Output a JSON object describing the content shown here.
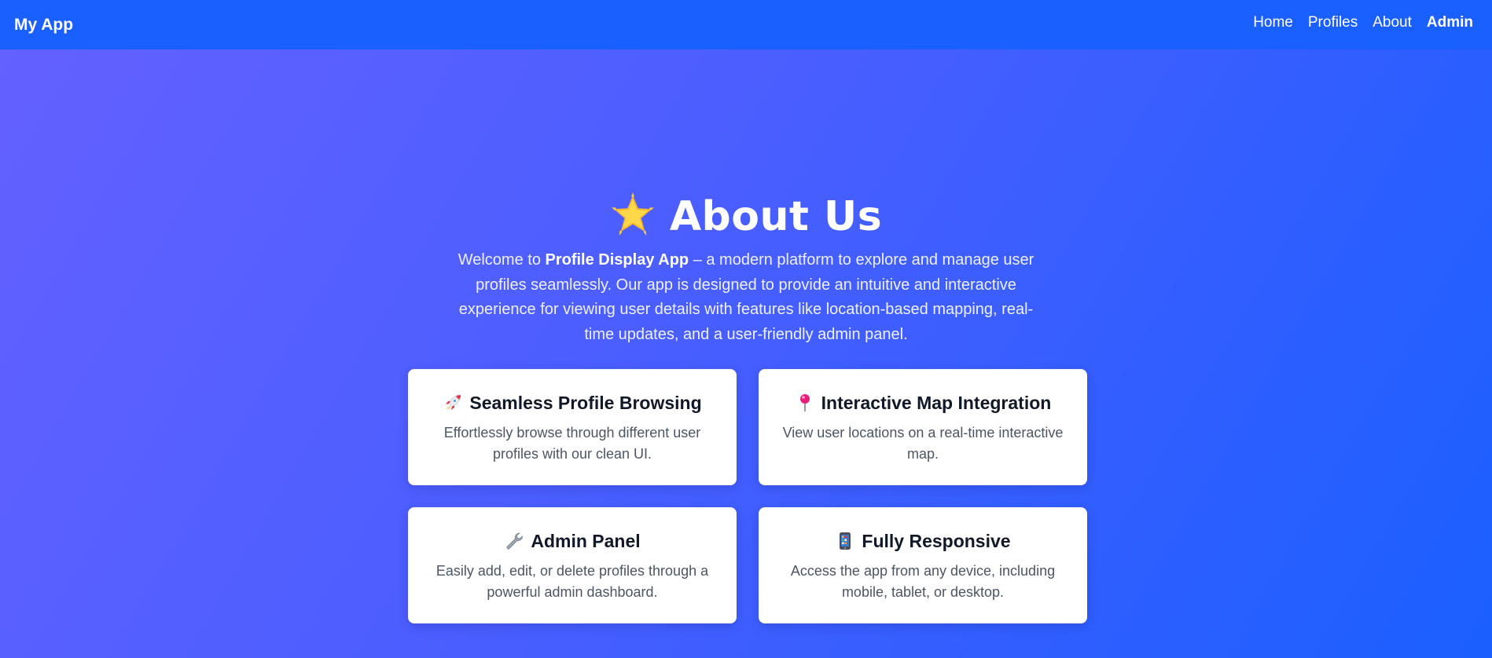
{
  "navbar": {
    "brand": "My App",
    "links": [
      {
        "label": "Home",
        "bold": false
      },
      {
        "label": "Profiles",
        "bold": false
      },
      {
        "label": "About",
        "bold": false
      },
      {
        "label": "Admin",
        "bold": true
      }
    ]
  },
  "hero": {
    "icon": "star-icon",
    "title": "About Us",
    "intro_before": "Welcome to ",
    "intro_bold": "Profile Display App",
    "intro_after": " – a modern platform to explore and manage user profiles seamlessly. Our app is designed to provide an intuitive and interactive experience for viewing user details with features like location-based mapping, real-time updates, and a user-friendly admin panel."
  },
  "features": [
    {
      "icon": "rocket-icon",
      "title": "Seamless Profile Browsing",
      "text": "Effortlessly browse through different user profiles with our clean UI."
    },
    {
      "icon": "map-pin-icon",
      "title": "Interactive Map Integration",
      "text": "View user locations on a real-time interactive map."
    },
    {
      "icon": "wrench-icon",
      "title": "Admin Panel",
      "text": "Easily add, edit, or delete profiles through a powerful admin dashboard."
    },
    {
      "icon": "mobile-phone-icon",
      "title": "Fully Responsive",
      "text": "Access the app from any device, including mobile, tablet, or desktop."
    }
  ],
  "colors": {
    "navbar_bg": "#1a5fff",
    "gradient_start": "#6461ff",
    "gradient_end": "#1b5fff",
    "card_title": "#111827",
    "card_text": "#4b5563"
  }
}
